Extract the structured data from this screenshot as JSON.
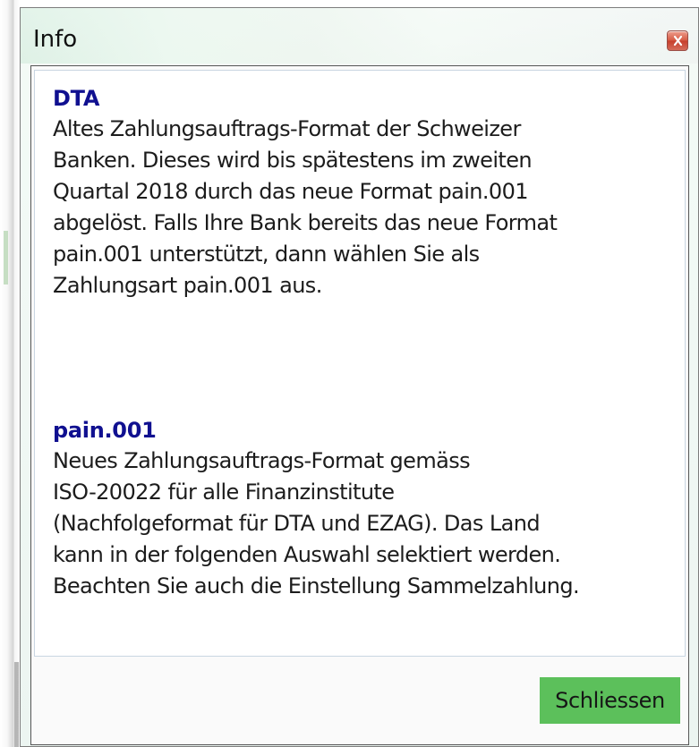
{
  "window": {
    "title": "Info",
    "close_icon": "close-icon"
  },
  "sections": [
    {
      "heading": "DTA",
      "lines": [
        "Altes Zahlungsauftrags-Format der Schweizer",
        "Banken. Dieses wird bis spätestens im zweiten",
        "Quartal 2018 durch das neue Format pain.001",
        "abgelöst. Falls Ihre Bank bereits das neue Format",
        "pain.001 unterstützt, dann wählen Sie als",
        "Zahlungsart pain.001 aus."
      ]
    },
    {
      "heading": "pain.001",
      "lines": [
        "Neues Zahlungsauftrags-Format gemäss",
        "ISO-20022 für alle Finanzinstitute",
        "(Nachfolgeformat für DTA und EZAG). Das Land",
        "kann in der folgenden Auswahl selektiert werden.",
        "Beachten Sie auch die Einstellung Sammelzahlung."
      ]
    }
  ],
  "footer": {
    "button_label": "Schliessen"
  },
  "colors": {
    "heading": "#101090",
    "button": "#5cc05b",
    "close_button": "#d65b45"
  }
}
